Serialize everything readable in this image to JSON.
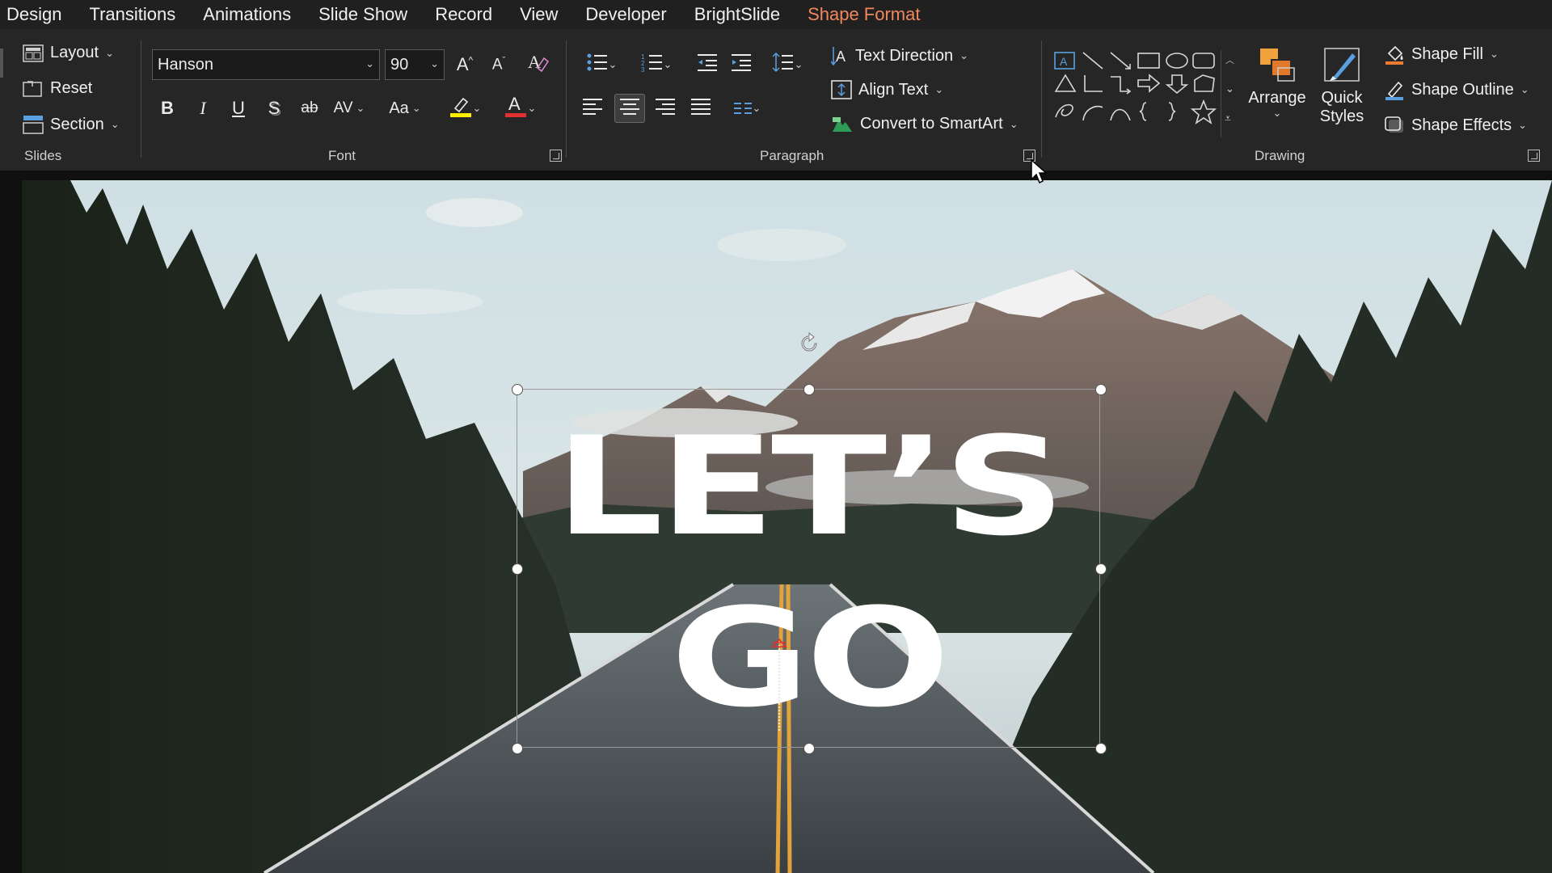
{
  "menu": {
    "tabs": [
      "Design",
      "Transitions",
      "Animations",
      "Slide Show",
      "Record",
      "View",
      "Developer",
      "BrightSlide",
      "Shape Format"
    ]
  },
  "slides_group": {
    "label": "Slides",
    "layout_label": "Layout",
    "reset_label": "Reset",
    "section_label": "Section"
  },
  "font_group": {
    "label": "Font",
    "font_name": "Hanson",
    "font_size": "90",
    "highlight_color": "#ffee00",
    "font_color": "#e03030"
  },
  "paragraph_group": {
    "label": "Paragraph",
    "text_direction_label": "Text Direction",
    "align_text_label": "Align Text",
    "convert_smartart_label": "Convert to SmartArt"
  },
  "drawing_group": {
    "label": "Drawing",
    "arrange_label": "Arrange",
    "quick_styles_label": "Quick Styles",
    "shape_fill_label": "Shape Fill",
    "shape_outline_label": "Shape Outline",
    "shape_effects_label": "Shape Effects"
  },
  "slide": {
    "title_line1": "LET’S",
    "title_line2": "GO"
  },
  "colors": {
    "accent_tab": "#f0885c",
    "ribbon_bg": "#262626",
    "menubar_bg": "#202020"
  }
}
